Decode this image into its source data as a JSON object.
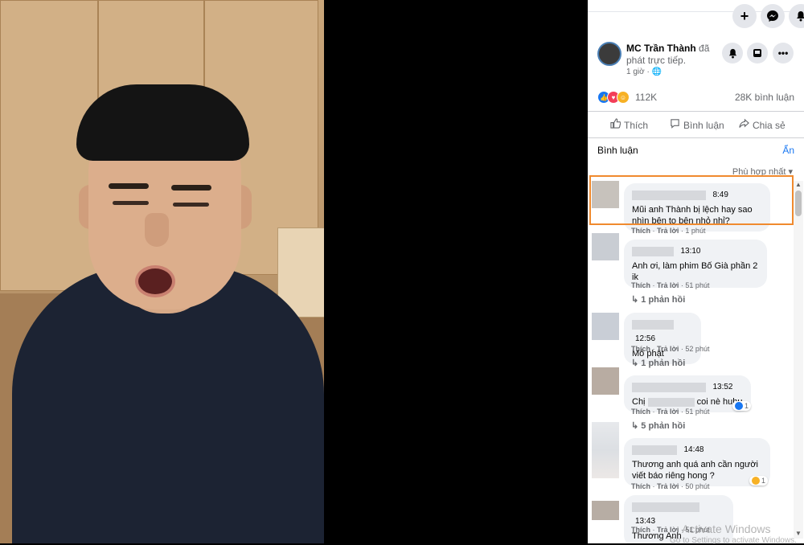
{
  "post": {
    "author": "MC Trần Thành",
    "verb": "đã phát trực tiếp.",
    "time": "1 giờ · 🌐"
  },
  "stats": {
    "reactions": "112K",
    "comments": "28K bình luận"
  },
  "actions": {
    "like": "Thích",
    "comment": "Bình luận",
    "share": "Chia sẻ"
  },
  "comments_section": {
    "label": "Bình luận",
    "hide": "Ẩn",
    "sort": "Phù hợp nhất ▾"
  },
  "comments": [
    {
      "time": "8:49",
      "text": "Mũi anh Thành bị lệch hay sao nhìn bên to bên nhỏ nhỉ?",
      "meta_like": "Thích",
      "meta_reply": "Trả lời",
      "meta_age": "1 phút",
      "replies": "",
      "reaction_count": ""
    },
    {
      "time": "13:10",
      "text": "Anh ơi, làm phim Bố Già phần 2 ik",
      "meta_like": "Thích",
      "meta_reply": "Trả lời",
      "meta_age": "51 phút",
      "replies": "1 phản hồi",
      "reaction_count": ""
    },
    {
      "time": "12:56",
      "text": "Mô phật",
      "meta_like": "Thích",
      "meta_reply": "Trả lời",
      "meta_age": "52 phút",
      "replies": "1 phản hồi",
      "reaction_count": ""
    },
    {
      "time": "13:52",
      "text_prefix": "Chị",
      "text_suffix": "coi nè huhu",
      "meta_like": "Thích",
      "meta_reply": "Trả lời",
      "meta_age": "51 phút",
      "replies": "5 phản hồi",
      "reaction_count": "1"
    },
    {
      "time": "14:48",
      "text": "Thương anh quá anh cần người viết báo riêng hong ?",
      "meta_like": "Thích",
      "meta_reply": "Trả lời",
      "meta_age": "50 phút",
      "replies": "",
      "reaction_count": "1"
    },
    {
      "time": "13:43",
      "text": "Thương Anh",
      "meta_like": "Thích",
      "meta_reply": "Trả lời",
      "meta_age": "51 phút",
      "replies": "",
      "reaction_count": ""
    }
  ],
  "reply_arrow": "↳",
  "watermark": {
    "title": "Activate Windows",
    "subtitle": "Go to Settings to activate Windows."
  },
  "colors": {
    "accent": "#1877f2",
    "highlight": "#f08a2e"
  },
  "icons": [
    "plus-icon",
    "messenger-icon",
    "bell-icon",
    "save-icon",
    "more-icon",
    "like-icon",
    "comment-icon",
    "share-icon",
    "globe-icon"
  ]
}
